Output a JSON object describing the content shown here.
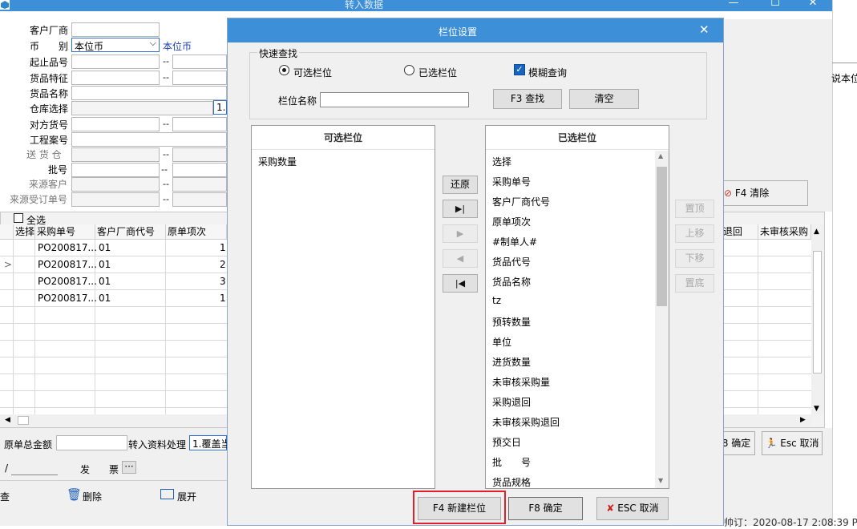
{
  "main_window": {
    "title": "转入数据",
    "controls": {
      "minimize": "—",
      "maximize": "☐",
      "close": "✕"
    },
    "filters": {
      "labels": [
        "客户厂商",
        "币　　别",
        "起止品号",
        "货品特征",
        "货品名称",
        "仓库选择",
        "对方货号",
        "工程案号",
        "送 货 仓",
        "批号",
        "来源客户",
        "来源受订单号"
      ],
      "currency_value": "本位币",
      "currency_text": "本位币",
      "warehouse_value": "1.",
      "range_dash": "--"
    },
    "clear_button": "F4 清除",
    "right_header": "说本位",
    "select_all": "全选",
    "grid": {
      "headers": [
        "选择",
        "采购单号",
        "客户厂商代号",
        "原单项次"
      ],
      "right_headers": [
        "退回",
        "未审核采购"
      ],
      "rows": [
        {
          "po": "PO200817...",
          "vendor": "01",
          "line": "1"
        },
        {
          "po": "PO200817...",
          "vendor": "01",
          "line": "2"
        },
        {
          "po": "PO200817...",
          "vendor": "01",
          "line": "3"
        },
        {
          "po": "PO200817...",
          "vendor": "01",
          "line": "1"
        }
      ],
      "row_pointer": ">"
    },
    "footer": {
      "total_label": "原单总金额",
      "process_label": "转入资料处理",
      "process_value": "1.覆盖当",
      "invoice_label_a": "发",
      "invoice_label_b": "票",
      "invoice_dots": "···",
      "slash": "/",
      "confirm": "8 确定",
      "cancel": "Esc 取消"
    },
    "bottom_toolbar": {
      "left": "查",
      "delete": "删除",
      "expand": "展开",
      "status_right": "帅订：2020-08-17 2:08:39 PM"
    }
  },
  "dialog": {
    "title": "栏位设置",
    "close": "✕",
    "quick_search": {
      "legend": "快速查找",
      "radio_available": "可选栏位",
      "radio_selected": "已选栏位",
      "fuzzy": "模糊查询",
      "field_name_label": "栏位名称",
      "field_name_value": "",
      "find_button": "F3 查找",
      "clear_button": "清空"
    },
    "available": {
      "header": "可选栏位",
      "items": [
        "采购数量"
      ]
    },
    "selected": {
      "header": "已选栏位",
      "items": [
        "选择",
        "采购单号",
        "客户厂商代号",
        "原单项次",
        "#制单人#",
        "货品代号",
        "货品名称",
        "tz",
        "预转数量",
        "单位",
        "进货数量",
        "未审核采购量",
        "采购退回",
        "未审核采购退回",
        "预交日",
        "批　　号",
        "货品规格"
      ]
    },
    "transfer": {
      "restore": "还原",
      "all_right": "▶|",
      "one_right": "▶",
      "one_left": "◀",
      "all_left": "|◀"
    },
    "order": {
      "top": "置顶",
      "up": "上移",
      "down": "下移",
      "bottom": "置底"
    },
    "footer": {
      "new_field": "F4 新建栏位",
      "ok": "F8 确定",
      "cancel": "ESC 取消"
    },
    "colors": {
      "title_bar": "#3d8fd8",
      "highlight_border": "#e0202a",
      "cancel_icon": "#cc1b1b"
    }
  }
}
